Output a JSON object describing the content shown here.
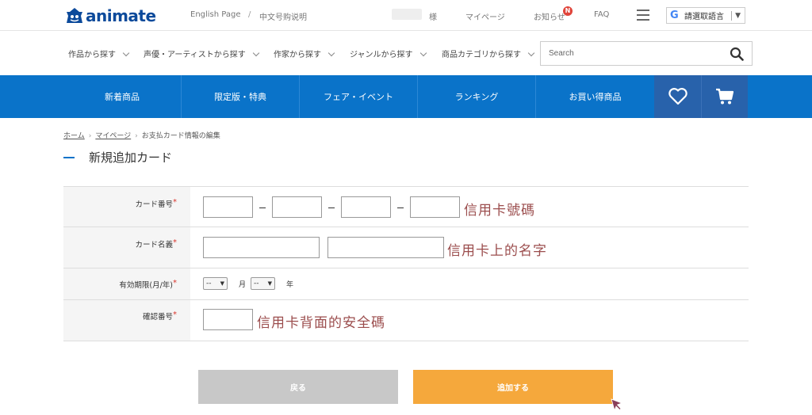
{
  "header": {
    "logo_text": "animate",
    "english_page": "English Page",
    "chinese_guide": "中文号购说明",
    "honorific": "様",
    "mypage": "マイページ",
    "notifications": "お知らせ",
    "notification_badge": "N",
    "faq": "FAQ",
    "language_select": "請選取語言",
    "language_arrow": "▼"
  },
  "catnav": {
    "items": [
      "作品から探す",
      "声優・アーティストから探す",
      "作家から探す",
      "ジャンルから探す",
      "商品カテゴリから探す"
    ],
    "search_placeholder": "Search"
  },
  "mainnav": {
    "items": [
      "新着商品",
      "限定版・特典",
      "フェア・イベント",
      "ランキング",
      "お買い得商品"
    ]
  },
  "breadcrumb": {
    "home": "ホーム",
    "mypage": "マイページ",
    "current": "お支払カード情報の編集"
  },
  "page_title": "新規追加カード",
  "form": {
    "card_number_label": "カード番号",
    "card_name_label": "カード名義",
    "expiry_label": "有効期限(月/年)",
    "cvv_label": "確認番号",
    "required_mark": "*",
    "card_number_note": "信用卡號碼",
    "card_name_note": "信用卡上的名字",
    "cvv_note": "信用卡背面的安全碼",
    "month_value": "--",
    "month_unit": "月",
    "year_value": "--",
    "year_unit": "年"
  },
  "buttons": {
    "back": "戻る",
    "add": "追加する"
  },
  "colors": {
    "brand_blue": "#0a73c9",
    "icon_block": "#2862ab",
    "add_button": "#f5a83c",
    "back_button": "#c8c8c8",
    "note_text": "#9b4d4d",
    "required": "#d9342b"
  }
}
